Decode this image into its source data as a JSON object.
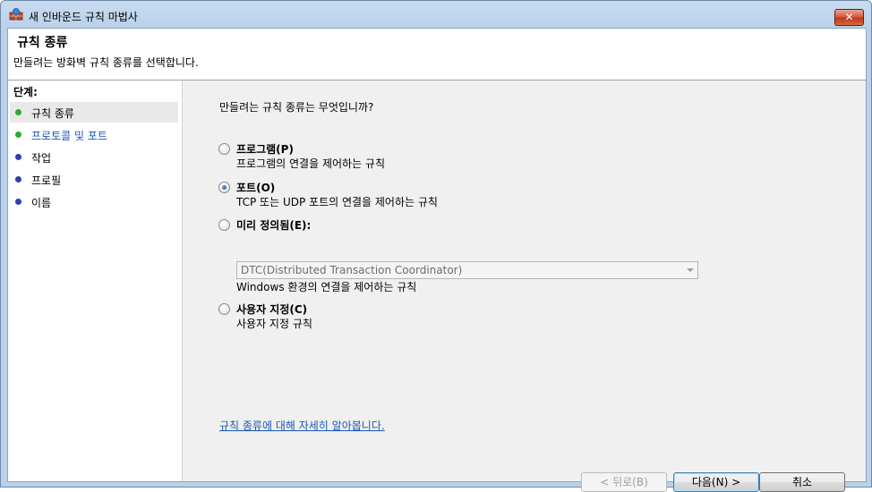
{
  "window": {
    "title": "새 인바운드 규칙 마법사",
    "close_label": "✕"
  },
  "header": {
    "title": "규칙 종류",
    "subtitle": "만들려는 방화벽 규칙 종류를 선택합니다."
  },
  "steps": {
    "label": "단계:",
    "items": [
      {
        "label": "규칙 종류",
        "status_color": "#2faa2f"
      },
      {
        "label": "프로토콜 및 포트",
        "status_color": "#2faa2f"
      },
      {
        "label": "작업",
        "status_color": "#2f3fb0"
      },
      {
        "label": "프로필",
        "status_color": "#2f3fb0"
      },
      {
        "label": "이름",
        "status_color": "#2f3fb0"
      }
    ]
  },
  "main": {
    "question": "만들려는 규칙 종류는 무엇입니까?",
    "options": [
      {
        "title": "프로그램(P)",
        "desc": "프로그램의 연결을 제어하는 규칙",
        "selected": false
      },
      {
        "title": "포트(O)",
        "desc": "TCP 또는 UDP 포트의 연결을 제어하는 규칙",
        "selected": true
      },
      {
        "title": "미리 정의됨(E):",
        "desc": "Windows 환경의 연결을 제어하는 규칙",
        "selected": false
      },
      {
        "title": "사용자 지정(C)",
        "desc": "사용자 지정 규칙",
        "selected": false
      }
    ],
    "predefined_select": "DTC(Distributed Transaction Coordinator)",
    "learn_more": "규칙 종류에 대해 자세히 알아봅니다."
  },
  "buttons": {
    "back": "< 뒤로(B)",
    "next": "다음(N) >",
    "cancel": "취소"
  }
}
